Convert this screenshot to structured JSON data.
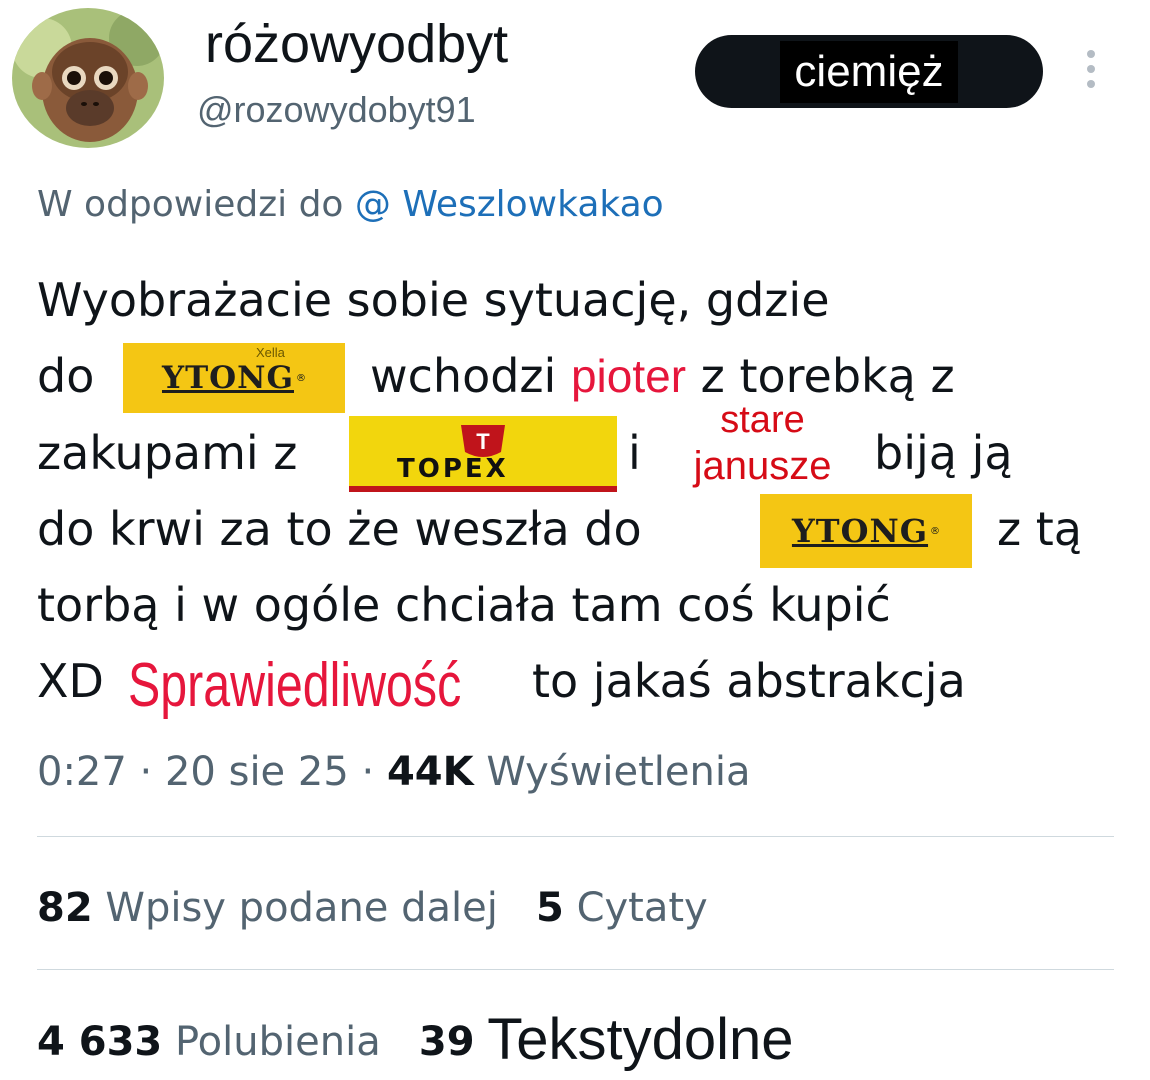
{
  "user": {
    "display_name": "różowyodbyt",
    "handle": "@rozowydobyt91",
    "follow_label": "ciemięż"
  },
  "reply": {
    "prefix": "W odpowiedzi do",
    "handle": "@ Weszlowkakao"
  },
  "tweet": {
    "line1": "Wyobrażacie sobie sytuację, gdzie",
    "line2_do": "do",
    "line2_rest": "wchodzi",
    "line2_name": "pioter",
    "line2_end": "z torebką z",
    "line3_start": "zakupami z",
    "line3_i": "i",
    "line3_end": "biją ją",
    "line4_start": "do krwi za to że weszła do",
    "line4_end": "z tą",
    "line5": "torbą i w ogóle chciała tam coś kupić",
    "line6_xd": "XD",
    "line6_red": "Sprawiedliwość",
    "line6_end": "to jakaś abstrakcja",
    "overlay_top": "stare",
    "overlay_bottom": "janusze"
  },
  "logos": {
    "ytong": "YTONG",
    "ytong_reg": "®",
    "xella": "Xella",
    "topex": "TOPEX",
    "topex_badge": "T",
    "ytong_color": "#f4c614",
    "topex_color": "#f2d60d",
    "topex_accent": "#c0141b"
  },
  "meta": {
    "time": "0:27",
    "sep1": "·",
    "date": "20 sie 25",
    "sep2": "·",
    "views_count": "44K",
    "views_label": "Wyświetlenia"
  },
  "stats": {
    "retweets_count": "82",
    "retweets_label": "Wpisy podane dalej",
    "quotes_count": "5",
    "quotes_label": "Cytaty",
    "likes_count": "4 633",
    "likes_label": "Polubienia",
    "bookmarks_count": "39",
    "bookmarks_label": "Tekstydolne"
  },
  "colors": {
    "text": "#0f1419",
    "muted": "#536471",
    "link": "#1d6fb8",
    "red": "#e6163c",
    "divider": "#cfd9de"
  },
  "icons": {
    "more": "more-vertical-icon",
    "avatar": "monkey-avatar"
  }
}
